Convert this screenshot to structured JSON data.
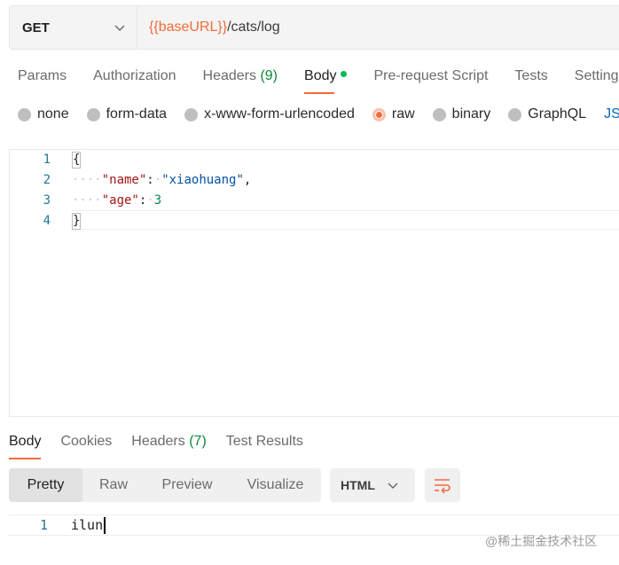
{
  "request": {
    "method": "GET",
    "url_variable": "{{baseURL}}",
    "url_path": "/cats/log"
  },
  "request_tabs": [
    {
      "label": "Params"
    },
    {
      "label": "Authorization"
    },
    {
      "label": "Headers",
      "count": "(9)"
    },
    {
      "label": "Body",
      "active": true,
      "indicator_color": "#0cbb52"
    },
    {
      "label": "Pre-request Script"
    },
    {
      "label": "Tests"
    },
    {
      "label": "Settings"
    }
  ],
  "body_types": [
    {
      "label": "none"
    },
    {
      "label": "form-data"
    },
    {
      "label": "x-www-form-urlencoded"
    },
    {
      "label": "raw",
      "checked": true
    },
    {
      "label": "binary"
    },
    {
      "label": "GraphQL"
    },
    {
      "label": "JSON"
    }
  ],
  "editor": {
    "line_numbers": [
      "1",
      "2",
      "3",
      "4"
    ],
    "lines": {
      "l1": "{",
      "l2_key": "\"name\"",
      "l2_value": "\"xiaohuang\"",
      "l3_key": "\"age\"",
      "l3_value": "3",
      "l4": "}"
    }
  },
  "response_tabs": [
    {
      "label": "Body",
      "active": true
    },
    {
      "label": "Cookies"
    },
    {
      "label": "Headers",
      "count": "(7)"
    },
    {
      "label": "Test Results"
    }
  ],
  "response_view": {
    "modes": [
      "Pretty",
      "Raw",
      "Preview",
      "Visualize"
    ],
    "active_mode": "Pretty",
    "format": "HTML"
  },
  "response_body": {
    "line_number": "1",
    "text": "ilun"
  },
  "watermark": "@稀土掘金技术社区",
  "colors": {
    "accent": "#f26b3a",
    "count_green": "#0b8a3c",
    "line_number": "#237893"
  }
}
